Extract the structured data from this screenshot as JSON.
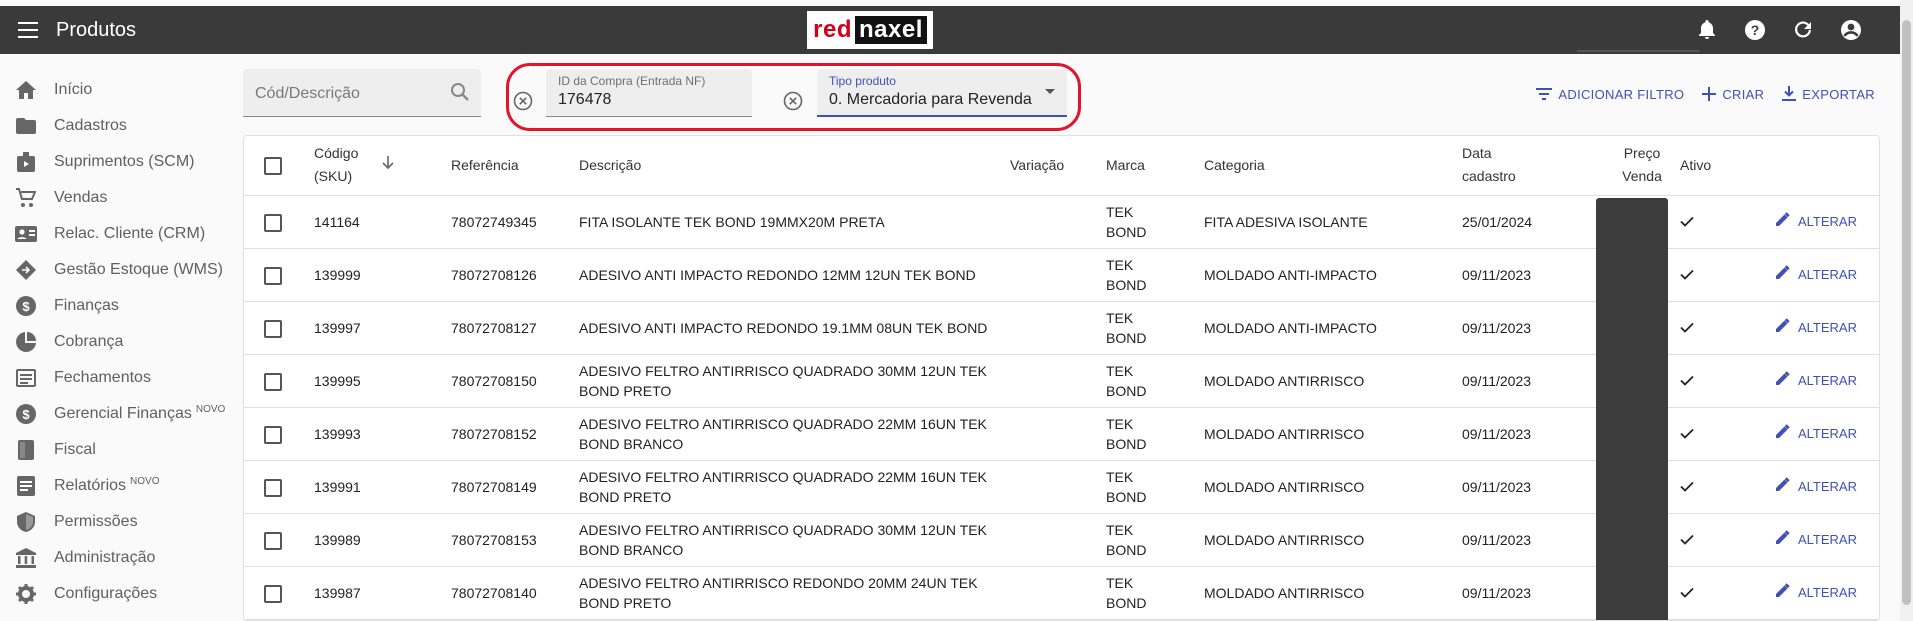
{
  "app": {
    "title": "Produtos",
    "logo_red": "red",
    "logo_dark": "naxel"
  },
  "sidebar": {
    "items": [
      {
        "label": "Início",
        "icon": "home-icon"
      },
      {
        "label": "Cadastros",
        "icon": "folder-icon"
      },
      {
        "label": "Suprimentos (SCM)",
        "icon": "supplies-icon"
      },
      {
        "label": "Vendas",
        "icon": "cart-icon"
      },
      {
        "label": "Relac. Cliente (CRM)",
        "icon": "contact-card-icon"
      },
      {
        "label": "Gestão Estoque (WMS)",
        "icon": "diamond-icon"
      },
      {
        "label": "Finanças",
        "icon": "dollar-icon"
      },
      {
        "label": "Cobrança",
        "icon": "pie-chart-icon"
      },
      {
        "label": "Fechamentos",
        "icon": "list-box-icon"
      },
      {
        "label": "Gerencial Finanças",
        "badge": "NOVO",
        "icon": "dollar-icon"
      },
      {
        "label": "Fiscal",
        "icon": "book-icon"
      },
      {
        "label": "Relatórios",
        "badge": "NOVO",
        "icon": "report-icon"
      },
      {
        "label": "Permissões",
        "icon": "shield-icon"
      },
      {
        "label": "Administração",
        "icon": "bank-icon"
      },
      {
        "label": "Configurações",
        "icon": "gear-icon"
      }
    ]
  },
  "filters": {
    "search_placeholder": "Cód/Descrição",
    "purchase_id": {
      "label": "ID da Compra (Entrada NF)",
      "value": "176478"
    },
    "product_type": {
      "label": "Tipo produto",
      "value": "0. Mercadoria para Revenda"
    }
  },
  "actions": {
    "add_filter": "ADICIONAR FILTRO",
    "create": "CRIAR",
    "export": "EXPORTAR"
  },
  "table": {
    "headers": {
      "sku_line1": "Código",
      "sku_line2": "(SKU)",
      "ref": "Referência",
      "desc": "Descrição",
      "variation": "Variação",
      "brand": "Marca",
      "category": "Categoria",
      "date_line1": "Data",
      "date_line2": "cadastro",
      "price_line1": "Preço",
      "price_line2": "Venda",
      "active": "Ativo"
    },
    "edit_label": "ALTERAR",
    "rows": [
      {
        "sku": "141164",
        "ref": "78072749345",
        "desc": "FITA ISOLANTE TEK BOND 19MMX20M PRETA",
        "brand1": "TEK",
        "brand2": "BOND",
        "category": "FITA ADESIVA ISOLANTE",
        "date": "25/01/2024"
      },
      {
        "sku": "139999",
        "ref": "78072708126",
        "desc": "ADESIVO ANTI IMPACTO REDONDO 12MM 12UN TEK BOND",
        "brand1": "TEK",
        "brand2": "BOND",
        "category": "MOLDADO ANTI-IMPACTO",
        "date": "09/11/2023"
      },
      {
        "sku": "139997",
        "ref": "78072708127",
        "desc": "ADESIVO ANTI IMPACTO REDONDO 19.1MM 08UN TEK BOND",
        "brand1": "TEK",
        "brand2": "BOND",
        "category": "MOLDADO ANTI-IMPACTO",
        "date": "09/11/2023"
      },
      {
        "sku": "139995",
        "ref": "78072708150",
        "desc": "ADESIVO FELTRO ANTIRRISCO QUADRADO 30MM 12UN TEK BOND PRETO",
        "brand1": "TEK",
        "brand2": "BOND",
        "category": "MOLDADO ANTIRRISCO",
        "date": "09/11/2023"
      },
      {
        "sku": "139993",
        "ref": "78072708152",
        "desc": "ADESIVO FELTRO ANTIRRISCO QUADRADO 22MM 16UN TEK BOND BRANCO",
        "brand1": "TEK",
        "brand2": "BOND",
        "category": "MOLDADO ANTIRRISCO",
        "date": "09/11/2023"
      },
      {
        "sku": "139991",
        "ref": "78072708149",
        "desc": "ADESIVO FELTRO ANTIRRISCO QUADRADO 22MM 16UN TEK BOND PRETO",
        "brand1": "TEK",
        "brand2": "BOND",
        "category": "MOLDADO ANTIRRISCO",
        "date": "09/11/2023"
      },
      {
        "sku": "139989",
        "ref": "78072708153",
        "desc": "ADESIVO FELTRO ANTIRRISCO QUADRADO 30MM 12UN TEK BOND BRANCO",
        "brand1": "TEK",
        "brand2": "BOND",
        "category": "MOLDADO ANTIRRISCO",
        "date": "09/11/2023"
      },
      {
        "sku": "139987",
        "ref": "78072708140",
        "desc": "ADESIVO FELTRO ANTIRRISCO REDONDO 20MM 24UN TEK BOND PRETO",
        "brand1": "TEK",
        "brand2": "BOND",
        "category": "MOLDADO ANTIRRISCO",
        "date": "09/11/2023"
      }
    ]
  },
  "colors": {
    "appbar": "#3a3a3a",
    "accent": "#3f51b5",
    "highlight": "#e0142c"
  }
}
